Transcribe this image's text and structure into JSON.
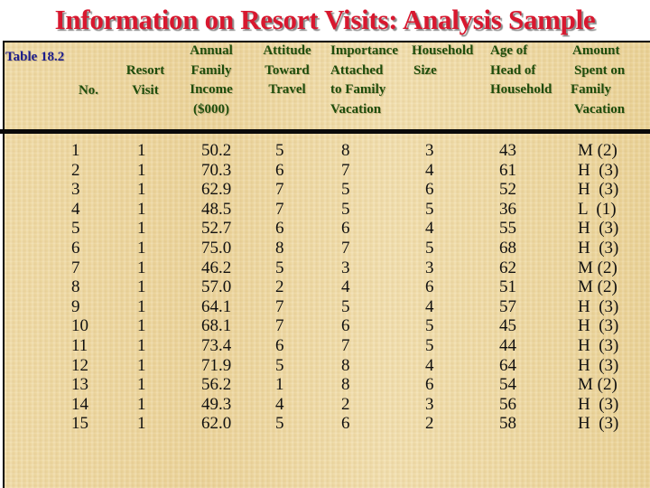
{
  "title": "Information on Resort Visits: Analysis Sample",
  "table_label": "Table 18.2",
  "headers": {
    "no": [
      "No."
    ],
    "resort_visit": [
      "Resort",
      "Visit"
    ],
    "income": [
      "Annual",
      "Family",
      "Income",
      "($000)"
    ],
    "attitude": [
      "Attitude",
      "Toward",
      "Travel"
    ],
    "importance": [
      "Importance",
      "Attached",
      "to Family",
      "Vacation"
    ],
    "household_size": [
      "Household",
      "Size"
    ],
    "age": [
      "Age of",
      "Head of",
      "Household"
    ],
    "amount": [
      "Amount",
      "Spent on",
      "Family",
      "Vacation"
    ]
  },
  "rows": [
    {
      "no": "1",
      "visit": "1",
      "income": "50.2",
      "attitude": "5",
      "importance": "8",
      "size": "3",
      "age": "43",
      "amount": "M (2)"
    },
    {
      "no": "2",
      "visit": "1",
      "income": "70.3",
      "attitude": "6",
      "importance": "7",
      "size": "4",
      "age": "61",
      "amount": "H  (3)"
    },
    {
      "no": "3",
      "visit": "1",
      "income": "62.9",
      "attitude": "7",
      "importance": "5",
      "size": "6",
      "age": "52",
      "amount": "H  (3)"
    },
    {
      "no": "4",
      "visit": "1",
      "income": "48.5",
      "attitude": "7",
      "importance": "5",
      "size": "5",
      "age": "36",
      "amount": "L  (1)"
    },
    {
      "no": "5",
      "visit": "1",
      "income": "52.7",
      "attitude": "6",
      "importance": "6",
      "size": "4",
      "age": "55",
      "amount": "H  (3)"
    },
    {
      "no": "6",
      "visit": "1",
      "income": "75.0",
      "attitude": "8",
      "importance": "7",
      "size": "5",
      "age": "68",
      "amount": "H  (3)"
    },
    {
      "no": "7",
      "visit": "1",
      "income": "46.2",
      "attitude": "5",
      "importance": "3",
      "size": "3",
      "age": "62",
      "amount": "M (2)"
    },
    {
      "no": "8",
      "visit": "1",
      "income": "57.0",
      "attitude": "2",
      "importance": "4",
      "size": "6",
      "age": "51",
      "amount": "M (2)"
    },
    {
      "no": "9",
      "visit": "1",
      "income": "64.1",
      "attitude": "7",
      "importance": "5",
      "size": "4",
      "age": "57",
      "amount": "H  (3)"
    },
    {
      "no": "10",
      "visit": "1",
      "income": "68.1",
      "attitude": "7",
      "importance": "6",
      "size": "5",
      "age": "45",
      "amount": "H  (3)"
    },
    {
      "no": "11",
      "visit": "1",
      "income": "73.4",
      "attitude": "6",
      "importance": "7",
      "size": "5",
      "age": "44",
      "amount": "H  (3)"
    },
    {
      "no": "12",
      "visit": "1",
      "income": "71.9",
      "attitude": "5",
      "importance": "8",
      "size": "4",
      "age": "64",
      "amount": "H  (3)"
    },
    {
      "no": "13",
      "visit": "1",
      "income": "56.2",
      "attitude": "1",
      "importance": "8",
      "size": "6",
      "age": "54",
      "amount": "M (2)"
    },
    {
      "no": "14",
      "visit": "1",
      "income": "49.3",
      "attitude": "4",
      "importance": "2",
      "size": "3",
      "age": "56",
      "amount": "H  (3)"
    },
    {
      "no": "15",
      "visit": "1",
      "income": "62.0",
      "attitude": "5",
      "importance": "6",
      "size": "2",
      "age": "58",
      "amount": "H  (3)"
    }
  ]
}
